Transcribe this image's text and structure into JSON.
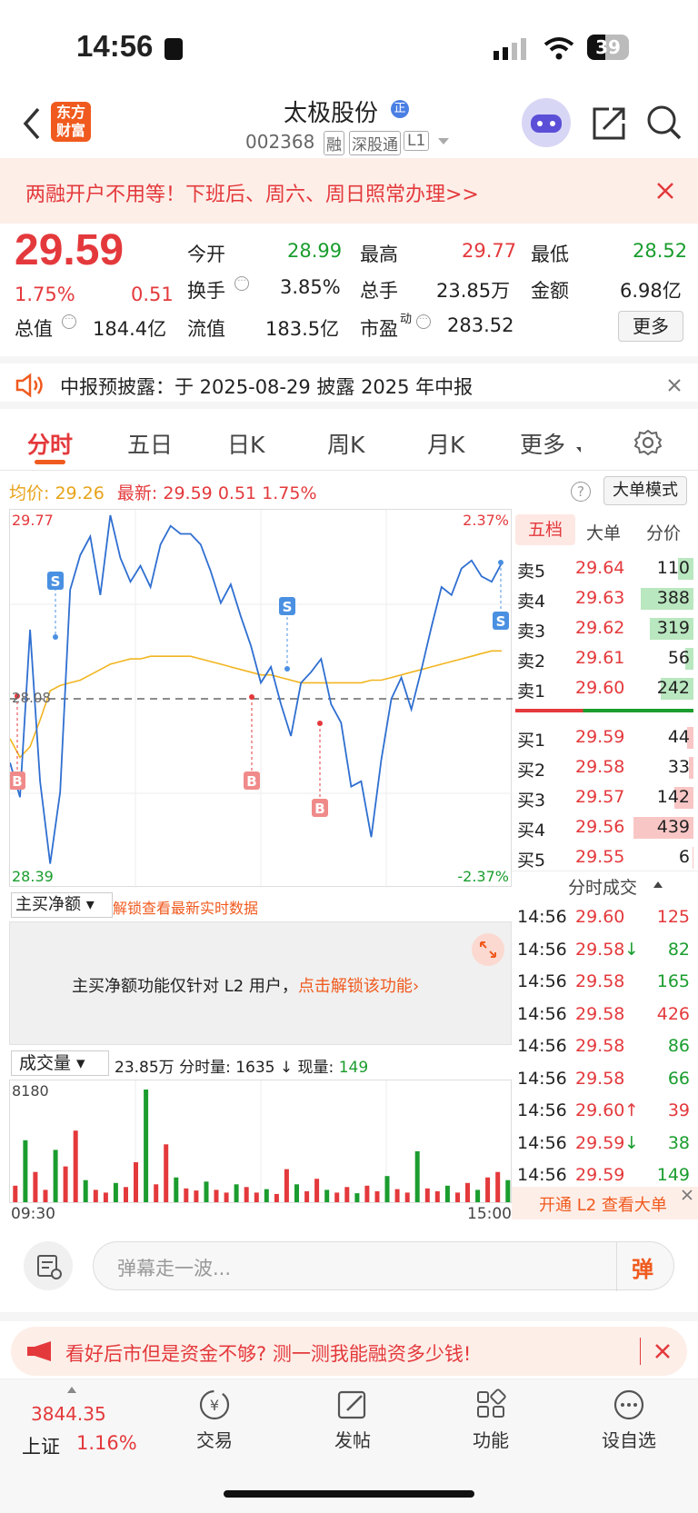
{
  "status": {
    "time": "14:56",
    "battery": "39"
  },
  "nav": {
    "logo_line1": "东方",
    "logo_line2": "财富",
    "stock_name": "太极股份",
    "badge": "正",
    "code": "002368",
    "tags": [
      "融",
      "深股通",
      "L1"
    ]
  },
  "banner": {
    "text": "两融开户不用等！下班后、周六、周日照常办理>>"
  },
  "quote": {
    "price": "29.59",
    "pct": "1.75%",
    "chg": "0.51",
    "open_label": "今开",
    "open": "28.99",
    "high_label": "最高",
    "high": "29.77",
    "low_label": "最低",
    "low": "28.52",
    "turnover_label": "换手",
    "turnover": "3.85%",
    "vol_label": "总手",
    "vol": "23.85万",
    "amt_label": "金额",
    "amt": "6.98亿",
    "mcap_label": "总值",
    "mcap": "184.4亿",
    "float_label": "流值",
    "float": "183.5亿",
    "pe_label": "市盈",
    "pe_sup": "动",
    "pe": "283.52",
    "more": "更多"
  },
  "notice": {
    "text": "中报预披露：于 2025-08-29 披露 2025 年中报"
  },
  "tabs": [
    "分时",
    "五日",
    "日K",
    "周K",
    "月K",
    "更多"
  ],
  "info": {
    "avg_label": "均价:",
    "avg": "29.26",
    "last_label": "最新:",
    "last": "29.59",
    "chg": "0.51",
    "pct": "1.75%",
    "mode": "大单模式"
  },
  "chart": {
    "top_price": "29.77",
    "bottom_price": "28.39",
    "top_pct": "2.37%",
    "bottom_pct": "-2.37%",
    "prev_close": "28.08",
    "time_start": "09:30",
    "time_end": "15:00"
  },
  "chart_data": {
    "type": "line",
    "series": [
      {
        "values": [
          28.84,
          28.71,
          29.34,
          28.77,
          28.46,
          28.73,
          29.49,
          29.62,
          29.69,
          29.47,
          29.77,
          29.61,
          29.52,
          29.58,
          29.5,
          29.66,
          29.73,
          29.7,
          29.7,
          29.66,
          29.56,
          29.44,
          29.51,
          29.39,
          29.28,
          29.14,
          29.2,
          29.06,
          28.94,
          29.14,
          29.18,
          29.23,
          29.06,
          28.99,
          28.75,
          28.77,
          28.56,
          28.85,
          29.08,
          29.16,
          29.04,
          29.19,
          29.35,
          29.5,
          29.47,
          29.57,
          29.6,
          29.54,
          29.52,
          29.59
        ]
      },
      {
        "values": [
          28.93,
          28.86,
          28.9,
          29.0,
          29.11,
          29.13,
          29.14,
          29.15,
          29.17,
          29.19,
          29.21,
          29.22,
          29.23,
          29.23,
          29.24,
          29.24,
          29.24,
          29.24,
          29.24,
          29.23,
          29.22,
          29.21,
          29.2,
          29.19,
          29.18,
          29.17,
          29.17,
          29.16,
          29.15,
          29.14,
          29.14,
          29.14,
          29.14,
          29.14,
          29.14,
          29.14,
          29.15,
          29.15,
          29.16,
          29.17,
          29.18,
          29.19,
          29.2,
          29.21,
          29.22,
          29.23,
          29.24,
          29.25,
          29.26,
          29.26
        ]
      }
    ],
    "ylim": [
      28.39,
      29.77
    ],
    "volume": [
      1200,
      4500,
      2200,
      900,
      3800,
      2600,
      5200,
      1600,
      900,
      700,
      1400,
      1100,
      2900,
      8180,
      1300,
      4200,
      1800,
      1000,
      850,
      1500,
      900,
      700,
      1300,
      1100,
      700,
      950,
      600,
      2400,
      1300,
      800,
      1700,
      900,
      700,
      1100,
      650,
      1200,
      800,
      1900,
      950,
      700,
      3700,
      1000,
      800,
      1200,
      700,
      1400,
      900,
      1800,
      2200,
      1600
    ]
  },
  "flow": {
    "label": "主买净额",
    "unlock": "解锁查看最新实时数据",
    "msg": "主买净额功能仅针对 L2 用户，",
    "link": "点击解锁该功能"
  },
  "volume_bar": {
    "label": "成交量",
    "total": "23.85万",
    "interval": "分时量: 1635",
    "now_label": "现量:",
    "now": "149",
    "max": "8180"
  },
  "orderbook": {
    "tabs": [
      "五档",
      "大单",
      "分价"
    ],
    "asks": [
      {
        "l": "卖5",
        "p": "29.64",
        "v": "110",
        "w": 0.25
      },
      {
        "l": "卖4",
        "p": "29.63",
        "v": "388",
        "w": 0.88
      },
      {
        "l": "卖3",
        "p": "29.62",
        "v": "319",
        "w": 0.73
      },
      {
        "l": "卖2",
        "p": "29.61",
        "v": "56",
        "w": 0.13
      },
      {
        "l": "卖1",
        "p": "29.60",
        "v": "242",
        "w": 0.55
      }
    ],
    "bids": [
      {
        "l": "买1",
        "p": "29.59",
        "v": "44",
        "w": 0.1
      },
      {
        "l": "买2",
        "p": "29.58",
        "v": "33",
        "w": 0.08
      },
      {
        "l": "买3",
        "p": "29.57",
        "v": "142",
        "w": 0.32
      },
      {
        "l": "买4",
        "p": "29.56",
        "v": "439",
        "w": 1.0
      },
      {
        "l": "买5",
        "p": "29.55",
        "v": "6",
        "w": 0.02
      }
    ],
    "trades_title": "分时成交",
    "trades": [
      {
        "t": "14:56",
        "p": "29.60",
        "a": "",
        "v": "125"
      },
      {
        "t": "14:56",
        "p": "29.58",
        "a": "↓",
        "v": "82"
      },
      {
        "t": "14:56",
        "p": "29.58",
        "a": "",
        "v": "165"
      },
      {
        "t": "14:56",
        "p": "29.58",
        "a": "",
        "v": "426"
      },
      {
        "t": "14:56",
        "p": "29.58",
        "a": "",
        "v": "86"
      },
      {
        "t": "14:56",
        "p": "29.58",
        "a": "",
        "v": "66"
      },
      {
        "t": "14:56",
        "p": "29.60",
        "a": "↑",
        "v": "39"
      },
      {
        "t": "14:56",
        "p": "29.59",
        "a": "↓",
        "v": "38"
      },
      {
        "t": "14:56",
        "p": "29.59",
        "a": "",
        "v": "149"
      }
    ],
    "l2": "开通 L2 查看大单"
  },
  "danmu": {
    "placeholder": "弹幕走一波...",
    "send": "弹"
  },
  "ad": {
    "text": "看好后市但是资金不够? 测一测我能融资多少钱!"
  },
  "bottom": {
    "index_value": "3844.35",
    "index_name": "上证",
    "index_pct": "1.16%",
    "items": [
      "交易",
      "发帖",
      "功能",
      "设自选"
    ]
  }
}
